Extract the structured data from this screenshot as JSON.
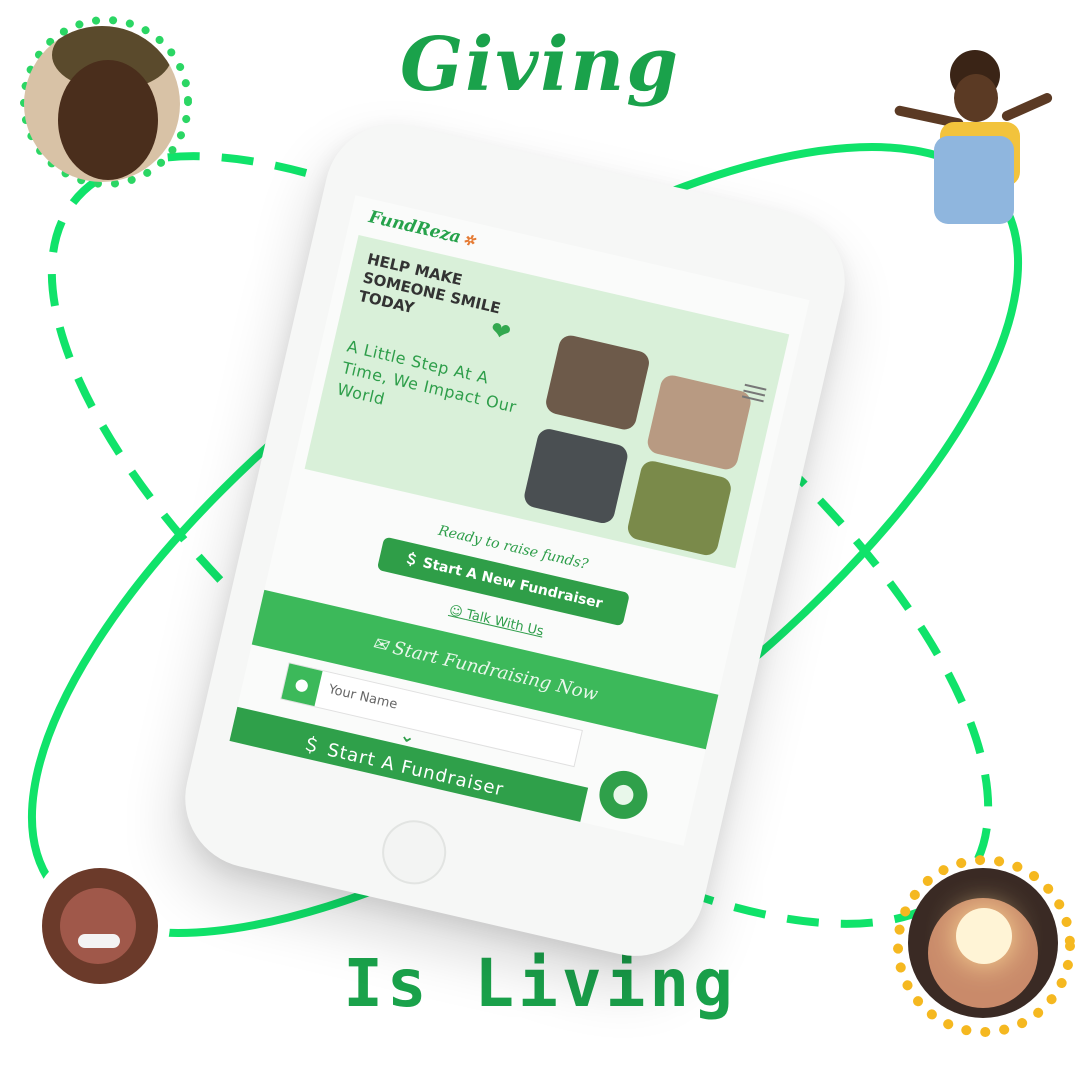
{
  "headline": {
    "top": "Giving",
    "bottom": "Is Living"
  },
  "colors": {
    "accent": "#1aa24b",
    "orbit": "#10e36a",
    "dots": "#2bd664",
    "gold": "#f5b820"
  },
  "phone_screen": {
    "logo": "FundReza",
    "menu_icon": "hamburger-menu-icon",
    "hero": {
      "title": "HELP MAKE SOMEONE SMILE TODAY",
      "subtitle": "A Little Step At A Time, We Impact Our World"
    },
    "cta_question": "Ready to raise funds?",
    "start_new_button": "Start A New Fundraiser",
    "talk_link": "Talk With Us",
    "banner": "Start Fundraising Now",
    "name_field": {
      "placeholder": "Your Name"
    },
    "start_button": "Start A Fundraiser"
  }
}
